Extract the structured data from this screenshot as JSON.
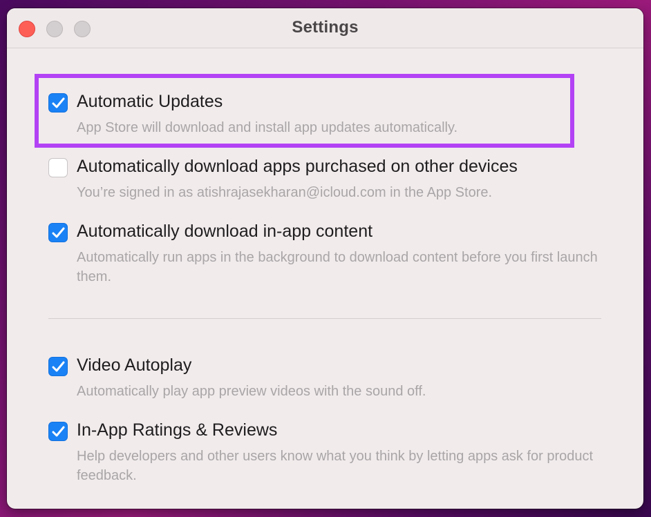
{
  "window": {
    "title": "Settings"
  },
  "colors": {
    "accent": "#1a82f5",
    "highlight": "#b342f5"
  },
  "options": [
    {
      "label": "Automatic Updates",
      "description": "App Store will download and install app updates automatically.",
      "checked": true
    },
    {
      "label": "Automatically download apps purchased on other devices",
      "description": "You’re signed in as atishrajasekharan@icloud.com in the App Store.",
      "checked": false
    },
    {
      "label": "Automatically download in-app content",
      "description": "Automatically run apps in the background to download content before you first launch them.",
      "checked": true
    },
    {
      "label": "Video Autoplay",
      "description": "Automatically play app preview videos with the sound off.",
      "checked": true
    },
    {
      "label": "In-App Ratings & Reviews",
      "description": "Help developers and other users know what you think by letting apps ask for product feedback.",
      "checked": true
    }
  ]
}
